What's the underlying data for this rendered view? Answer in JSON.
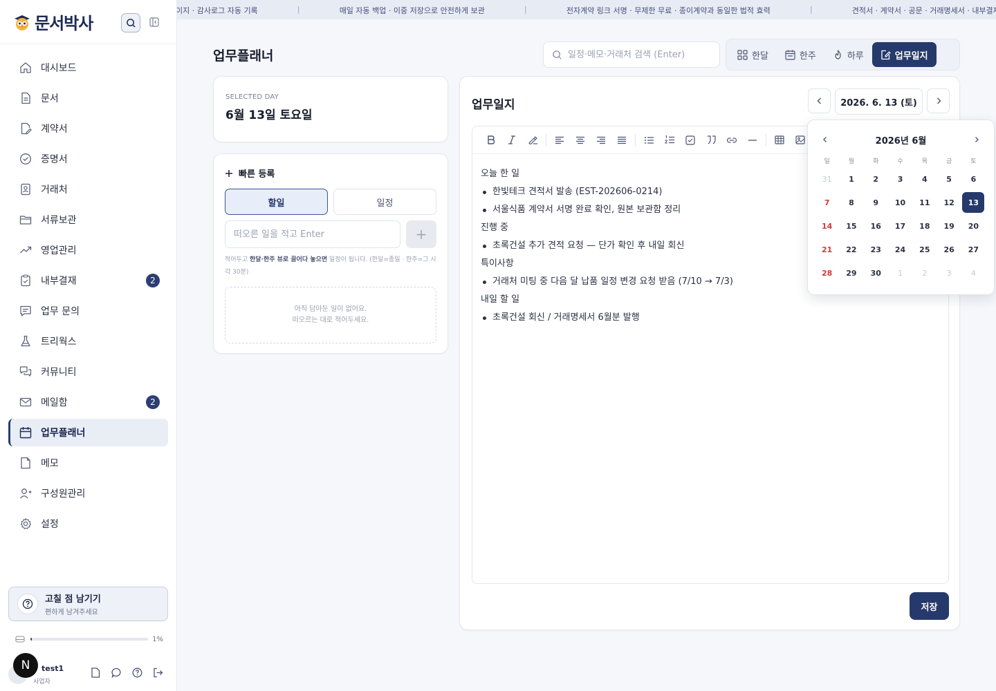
{
  "brand": {
    "name": "문서박사"
  },
  "ticker": [
    "이지 · 감사로그 자동 기록",
    "매일 자동 백업 · 이중 저장으로 안전하게 보관",
    "전자계약 링크 서명 · 무제한 무료 · 종이계약과 동일한 법적 효력",
    "견적서 · 계약서 · 공문 · 거래명세서 · 내부결재"
  ],
  "sidebar": {
    "items": [
      {
        "label": "대시보드",
        "icon": "home-icon"
      },
      {
        "label": "문서",
        "icon": "document-icon"
      },
      {
        "label": "계약서",
        "icon": "contract-icon"
      },
      {
        "label": "증명서",
        "icon": "certificate-icon"
      },
      {
        "label": "거래처",
        "icon": "client-icon"
      },
      {
        "label": "서류보관",
        "icon": "folder-icon"
      },
      {
        "label": "영업관리",
        "icon": "trend-icon"
      },
      {
        "label": "내부결재",
        "icon": "approval-icon",
        "badge": "2"
      },
      {
        "label": "업무 문의",
        "icon": "inquiry-icon"
      },
      {
        "label": "트리웍스",
        "icon": "flask-icon"
      },
      {
        "label": "커뮤니티",
        "icon": "community-icon"
      },
      {
        "label": "메일함",
        "icon": "mail-icon",
        "badge": "2"
      },
      {
        "label": "업무플래너",
        "icon": "calendar-icon",
        "active": true
      },
      {
        "label": "메모",
        "icon": "memo-icon"
      },
      {
        "label": "구성원관리",
        "icon": "user-add-icon"
      },
      {
        "label": "설정",
        "icon": "settings-icon"
      }
    ],
    "feedback": {
      "title": "고칠 점 남기기",
      "subtitle": "편하게 남겨주세요"
    },
    "storage": {
      "percent_label": "1%",
      "fraction": 0.01
    },
    "user": {
      "initial": "N",
      "name": "test1",
      "role": "사업자"
    }
  },
  "main": {
    "title": "업무플래너",
    "search": {
      "placeholder": "일정·메모·거래처 검색 (Enter)",
      "value": ""
    },
    "views": [
      {
        "label": "한달",
        "icon": "grid-icon"
      },
      {
        "label": "한주",
        "icon": "week-icon"
      },
      {
        "label": "하루",
        "icon": "flame-icon"
      },
      {
        "label": "업무일지",
        "icon": "journal-icon",
        "active": true
      }
    ],
    "selected_day": {
      "label": "SELECTED DAY",
      "value": "6월 13일 토요일"
    },
    "quick": {
      "title": "빠른 등록",
      "tabs": [
        "할일",
        "일정"
      ],
      "input_placeholder": "떠오른 일을 적고 Enter",
      "hint_pre": "적어두고 ",
      "hint_bold": "한달·한주 뷰로 끌어다 놓으면",
      "hint_post": " 일정이 됩니다. (한달=종일 · 한주=그 시각 30분)",
      "empty_line1": "아직 담아둔 일이 없어요.",
      "empty_line2": "떠오르는 대로 적어두세요."
    },
    "journal": {
      "title": "업무일지",
      "date": "2026. 6. 13 (토)",
      "sections": [
        {
          "heading": "오늘 한 일",
          "items": [
            "한빛테크 견적서 발송 (EST-202606-0214)",
            "서울식품 계약서 서명 완료 확인, 원본 보관함 정리"
          ]
        },
        {
          "heading": "진행 중",
          "items": [
            "초록건설 추가 견적 요청 — 단가 확인 후 내일 회신"
          ]
        },
        {
          "heading": "특이사항",
          "items": [
            "거래처 미팅 중 다음 달 납품 일정 변경 요청 받음 (7/10 → 7/3)"
          ]
        },
        {
          "heading": "내일 할 일",
          "items": [
            "초록건설 회신 / 거래명세서 6월분 발행"
          ]
        }
      ],
      "save_label": "저장"
    },
    "calendar": {
      "title": "2026년 6월",
      "weekdays": [
        "일",
        "월",
        "화",
        "수",
        "목",
        "금",
        "토"
      ],
      "days": [
        "31",
        "1",
        "2",
        "3",
        "4",
        "5",
        "6",
        "7",
        "8",
        "9",
        "10",
        "11",
        "12",
        "13",
        "14",
        "15",
        "16",
        "17",
        "18",
        "19",
        "20",
        "21",
        "22",
        "23",
        "24",
        "25",
        "26",
        "27",
        "28",
        "29",
        "30",
        "1",
        "2",
        "3",
        "4"
      ],
      "selected": "13",
      "colors": {
        "accent": "#26396b",
        "sunday": "#d33a3a"
      }
    }
  }
}
